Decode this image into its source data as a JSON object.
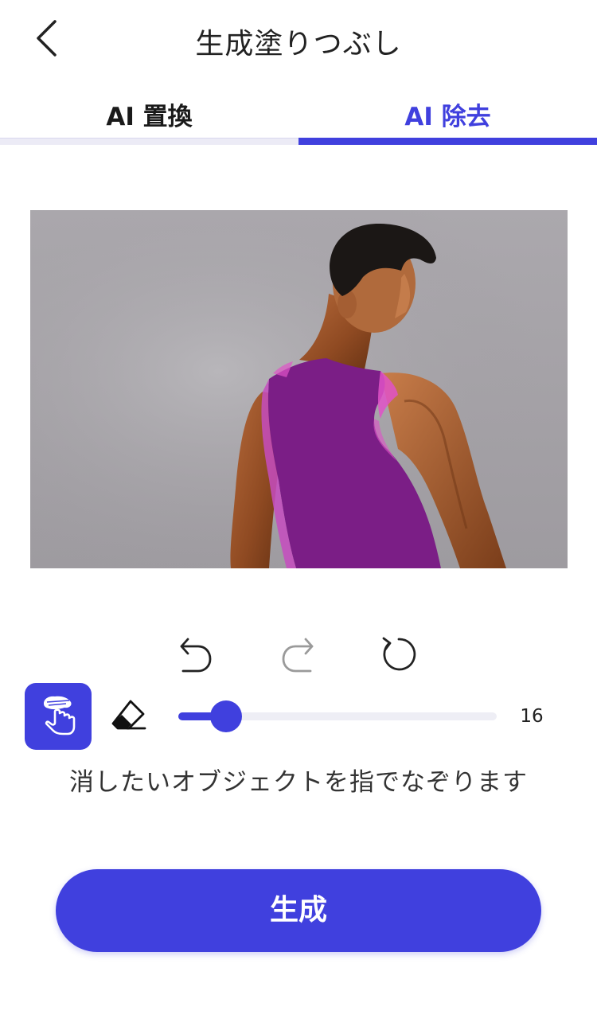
{
  "header": {
    "title": "生成塗りつぶし",
    "back_icon": "chevron-left-icon"
  },
  "tabs": [
    {
      "label": "AI 置換",
      "active": false
    },
    {
      "label": "AI 除去",
      "active": true
    }
  ],
  "colors": {
    "accent": "#4040de",
    "mask": "#7b1e86",
    "mask_edge": "#e052c8",
    "text": "#222222"
  },
  "canvas": {
    "image": "man-in-tank-top-photo",
    "mask_overlay": "purple-selection-mask"
  },
  "history": {
    "undo_icon": "undo-icon",
    "redo_icon": "redo-icon",
    "reset_icon": "reset-icon",
    "redo_enabled": false
  },
  "tools": {
    "brush_icon": "brush-hand-icon",
    "eraser_icon": "eraser-icon",
    "brush_active": true,
    "brush_size": "16",
    "brush_size_fraction": 0.15
  },
  "hint": "消したいオブジェクトを指でなぞります",
  "generate_label": "生成"
}
